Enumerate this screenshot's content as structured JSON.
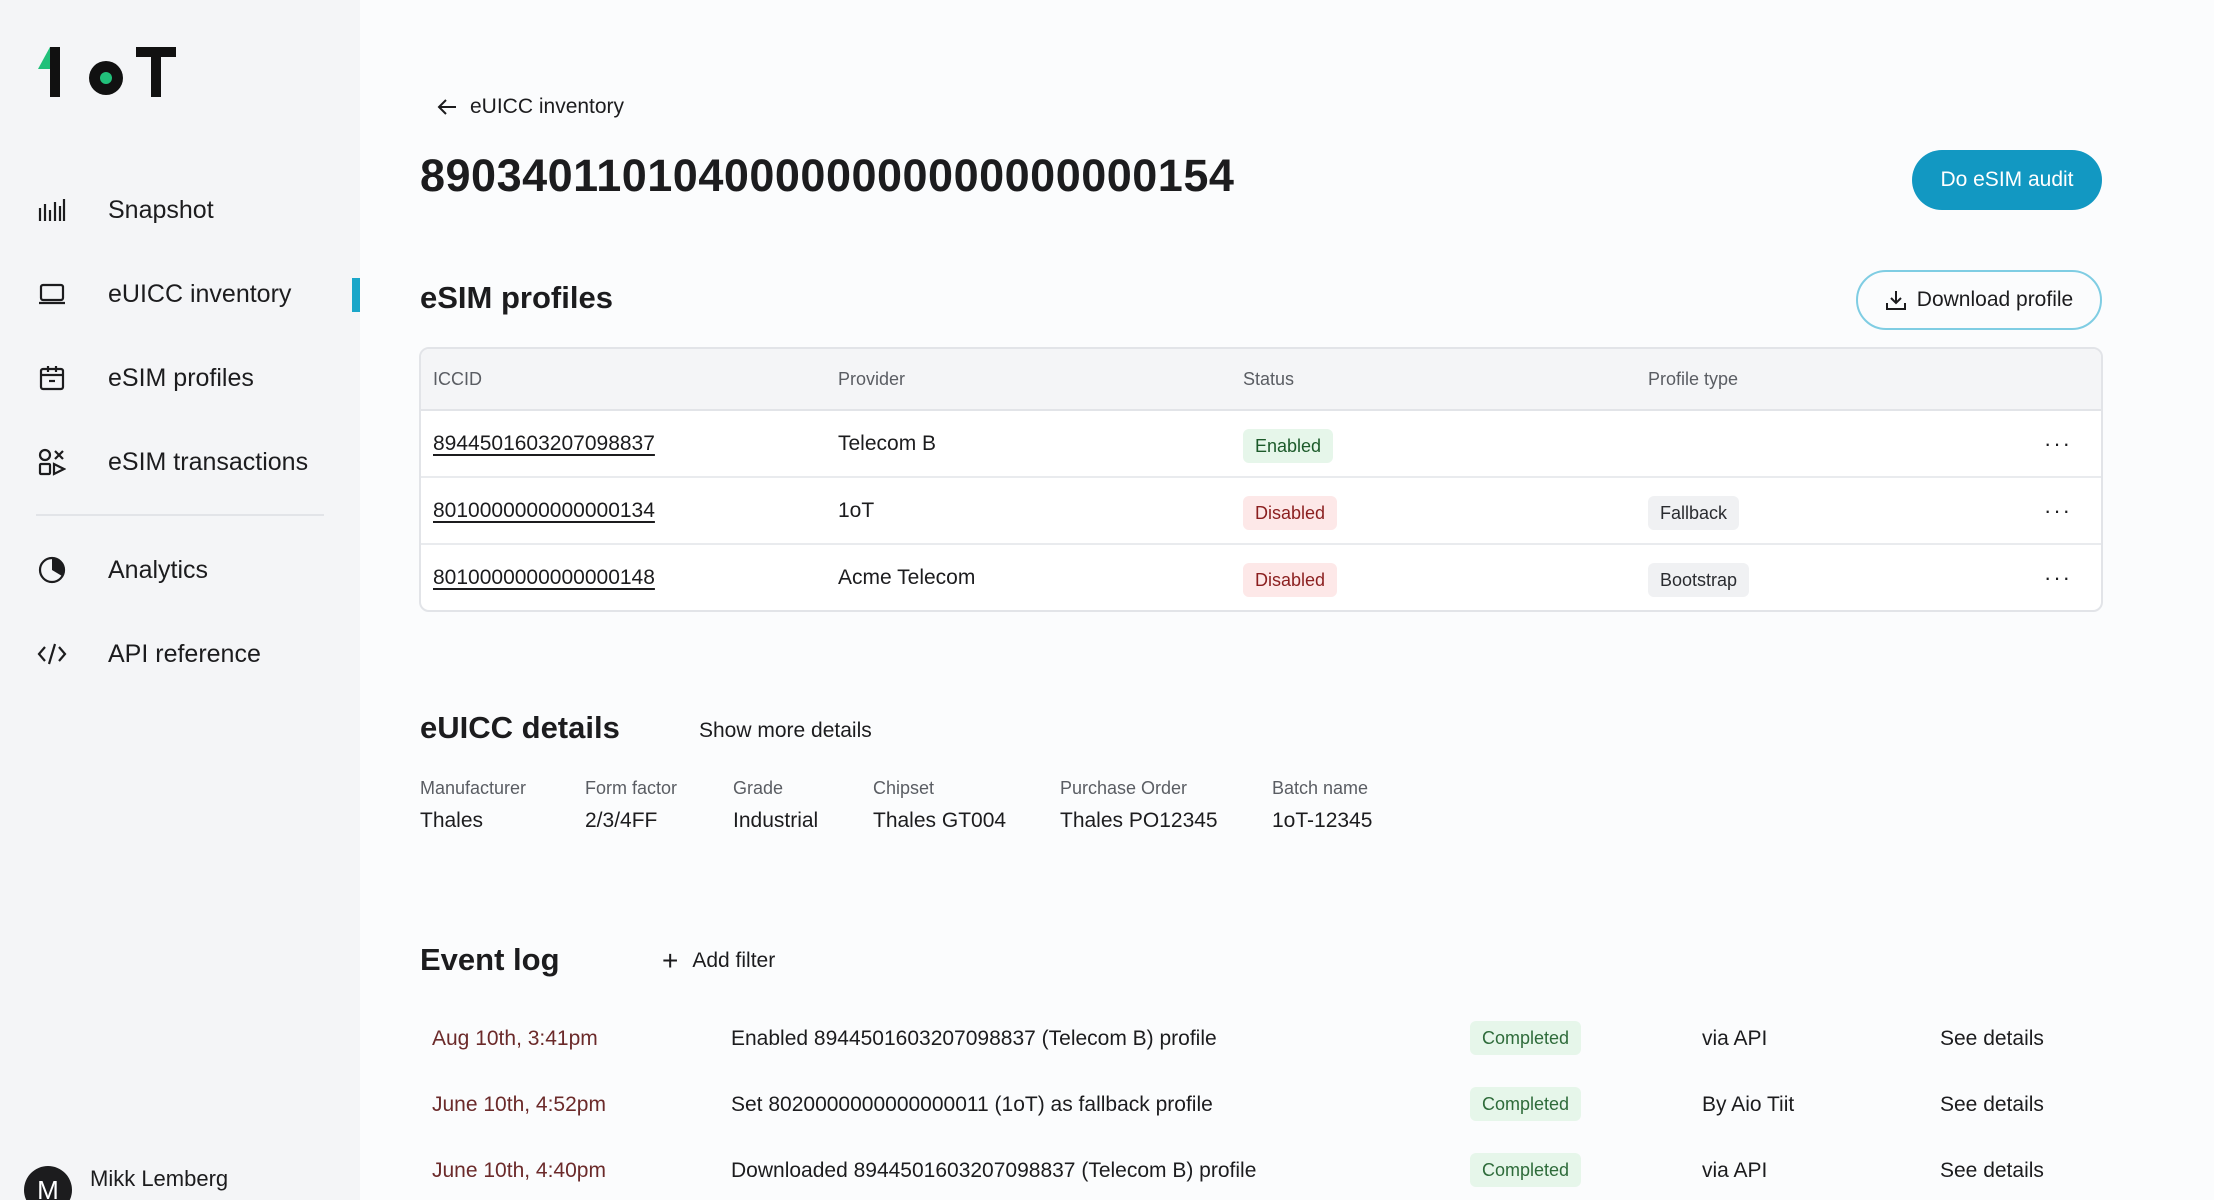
{
  "brand": {
    "logo_text": "1oT",
    "accent": "#1aa6c9",
    "primary_button": "#1298c2"
  },
  "sidebar": {
    "items": [
      {
        "label": "Snapshot",
        "icon": "bar-chart-icon"
      },
      {
        "label": "eUICC inventory",
        "icon": "laptop-icon",
        "active": true
      },
      {
        "label": "eSIM profiles",
        "icon": "sim-box-icon"
      },
      {
        "label": "eSIM transactions",
        "icon": "transactions-icon"
      },
      {
        "label": "Analytics",
        "icon": "pie-chart-icon"
      },
      {
        "label": "API reference",
        "icon": "code-icon"
      }
    ],
    "user": {
      "initial": "M",
      "name": "Mikk Lemberg"
    }
  },
  "header": {
    "back_label": "eUICC inventory",
    "title": "89034011010400000000000000000154",
    "audit_button": "Do eSIM audit"
  },
  "profiles": {
    "title": "eSIM profiles",
    "download_button": "Download profile",
    "columns": [
      "ICCID",
      "Provider",
      "Status",
      "Profile type"
    ],
    "rows": [
      {
        "iccid": "8944501603207098837",
        "provider": "Telecom B",
        "status": "Enabled",
        "type": ""
      },
      {
        "iccid": "8010000000000000134",
        "provider": "1oT",
        "status": "Disabled",
        "type": "Fallback"
      },
      {
        "iccid": "8010000000000000148",
        "provider": "Acme Telecom",
        "status": "Disabled",
        "type": "Bootstrap"
      }
    ],
    "more_label": "···"
  },
  "euicc": {
    "title": "eUICC details",
    "show_more": "Show more details",
    "fields": [
      {
        "label": "Manufacturer",
        "value": "Thales"
      },
      {
        "label": "Form factor",
        "value": "2/3/4FF"
      },
      {
        "label": "Grade",
        "value": "Industrial"
      },
      {
        "label": "Chipset",
        "value": "Thales GT004"
      },
      {
        "label": "Purchase Order",
        "value": "Thales PO12345"
      },
      {
        "label": "Batch name",
        "value": "1oT-12345"
      }
    ]
  },
  "events": {
    "title": "Event log",
    "add_filter": "Add filter",
    "rows": [
      {
        "date": "Aug 10th, 3:41pm",
        "desc": "Enabled 8944501603207098837 (Telecom B) profile",
        "status": "Completed",
        "via": "via API",
        "link": "See details"
      },
      {
        "date": "June 10th, 4:52pm",
        "desc": "Set 8020000000000000011 (1oT) as fallback profile",
        "status": "Completed",
        "via": "By Aio Tiit",
        "link": "See details"
      },
      {
        "date": "June 10th, 4:40pm",
        "desc": "Downloaded 8944501603207098837 (Telecom B) profile",
        "status": "Completed",
        "via": "via API",
        "link": "See details"
      }
    ]
  }
}
